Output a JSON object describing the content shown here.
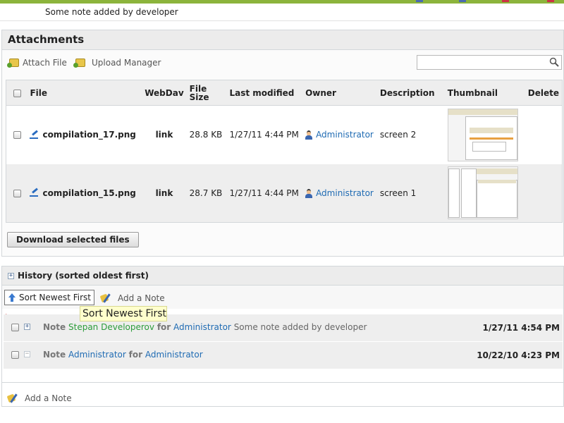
{
  "colors": {
    "accent_green": "#8cb43c",
    "link_blue": "#1f6bb3",
    "user_green": "#2c9c3c",
    "tooltip_bg": "#ffffcc"
  },
  "previous_note": {
    "text": "Some note added by developer"
  },
  "attachments": {
    "title": "Attachments",
    "attach_file": "Attach File",
    "upload_manager": "Upload Manager",
    "search": {
      "value": "",
      "placeholder": ""
    },
    "columns": [
      "File",
      "WebDav",
      "File Size",
      "Last modified",
      "Owner",
      "Description",
      "Thumbnail",
      "Delete"
    ],
    "rows": [
      {
        "file": "compilation_17.png",
        "webdav": "link",
        "size": "28.8 KB",
        "modified": "1/27/11 4:44 PM",
        "owner": "Administrator",
        "description": "screen 2",
        "thumbnail_icon": "screenshot-thumbnail"
      },
      {
        "file": "compilation_15.png",
        "webdav": "link",
        "size": "28.7 KB",
        "modified": "1/27/11 4:44 PM",
        "owner": "Administrator",
        "description": "screen 1",
        "thumbnail_icon": "screenshot-thumbnail"
      }
    ],
    "download_label": "Download selected files"
  },
  "history": {
    "title": "History (sorted oldest first)",
    "sort_label": "Sort Newest First",
    "add_note_label": "Add a Note",
    "tooltip": "Sort Newest First",
    "required_mark": "*",
    "entries": [
      {
        "type": "Note",
        "author": "Stepan Developerov",
        "for_word": "for",
        "target": "Administrator",
        "text": "Some note added by developer",
        "date": "1/27/11 4:54 PM",
        "expand_icon": "plus"
      },
      {
        "type": "Note",
        "author": "Administrator",
        "for_word": "for",
        "target": "Administrator",
        "text": "",
        "date": "10/22/10 4:23 PM",
        "expand_icon": "minus"
      }
    ],
    "bottom_add_note": "Add a Note"
  }
}
